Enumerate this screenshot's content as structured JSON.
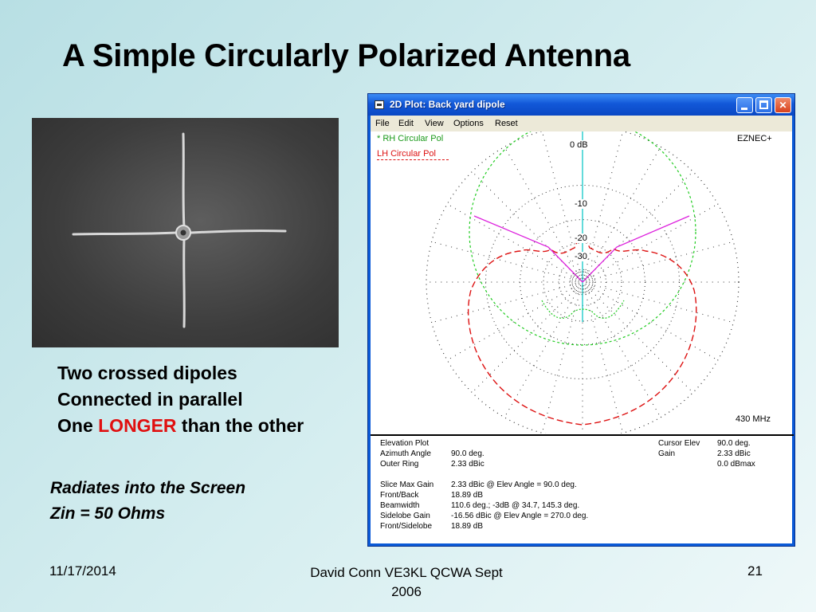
{
  "slide": {
    "title": "A Simple Circularly Polarized Antenna",
    "bullets": [
      "Two crossed dipoles",
      "Connected in parallel"
    ],
    "bullet3_pre": "One ",
    "bullet3_red": "LONGER",
    "bullet3_post": " than the other",
    "note1": "Radiates into the Screen",
    "note2": "Zin  = 50 Ohms",
    "footer_date": "11/17/2014",
    "footer_center_line1": "David Conn   VE3KL  QCWA Sept",
    "footer_center_line2": "2006",
    "footer_page": "21"
  },
  "window": {
    "title": "2D Plot: Back yard dipole",
    "menu": [
      "File",
      "Edit",
      "View",
      "Options",
      "Reset"
    ]
  },
  "plot": {
    "legend_rh": "RH Circular Pol",
    "legend_lh": "LH Circular Pol",
    "brand": "EZNEC+",
    "frequency": "430 MHz",
    "ring_labels": [
      "0 dB",
      "-10",
      "-20",
      "-30"
    ],
    "colors": {
      "rh": "#22cc22",
      "lh": "#dd1111",
      "cursor": "#dd22dd",
      "axis": "#22cccc",
      "grid": "#333333"
    }
  },
  "info": {
    "left_labels": [
      "Elevation Plot",
      "Azimuth Angle",
      "Outer Ring",
      "",
      "Slice Max Gain",
      "Front/Back",
      "Beamwidth",
      "Sidelobe Gain",
      "Front/Sidelobe"
    ],
    "left_values": [
      "",
      "90.0 deg.",
      "2.33 dBic",
      "",
      "2.33 dBic @ Elev Angle = 90.0 deg.",
      "18.89 dB",
      "110.6 deg.; -3dB @ 34.7, 145.3 deg.",
      "-16.56 dBic @ Elev Angle = 270.0 deg.",
      "18.89 dB"
    ],
    "right_labels": [
      "Cursor Elev",
      "Gain",
      ""
    ],
    "right_values": [
      "90.0 deg.",
      "2.33 dBic",
      "0.0 dBmax"
    ]
  }
}
